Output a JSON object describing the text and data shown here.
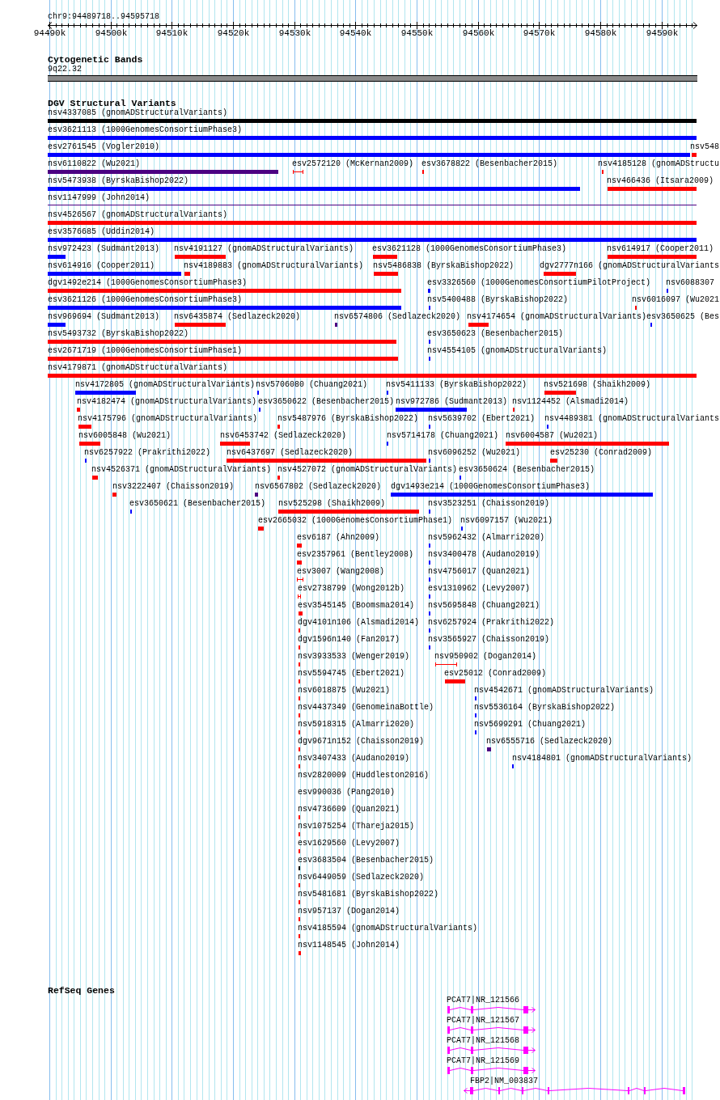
{
  "location": "chr9:94489718..94595718",
  "ruler": {
    "ticks": [
      "94490k",
      "94500k",
      "94510k",
      "94520k",
      "94530k",
      "94540k",
      "94550k",
      "94560k",
      "94570k",
      "94580k",
      "94590k"
    ]
  },
  "cytogenetic_bands": {
    "title": "Cytogenetic Bands",
    "bands": [
      {
        "label": "9q22.32"
      }
    ]
  },
  "dgv": {
    "title": "DGV Structural Variants",
    "rows": [
      {
        "features": [
          {
            "label": "nsv4337085 (gnomADStructuralVariants)",
            "kind": "bar",
            "color": "#000000"
          }
        ]
      },
      {
        "features": [
          {
            "label": "esv3621113 (1000GenomesConsortiumPhase3)",
            "kind": "bar",
            "color": "#0000ff"
          }
        ]
      },
      {
        "features": [
          {
            "label": "esv2761545 (Vogler2010)",
            "kind": "bar",
            "color": "#0000ff"
          },
          {
            "label": "nsv548",
            "kind": "bar",
            "color": "#ff0000"
          }
        ]
      },
      {
        "features": [
          {
            "label": "nsv6110822 (Wu2021)",
            "kind": "bar",
            "color": "#4b0082"
          },
          {
            "label": "esv2572120 (McKernan2009)",
            "kind": "span",
            "color": "#ff0000"
          },
          {
            "label": "esv3678822 (Besenbacher2015)",
            "kind": "bar",
            "color": "#ff0000"
          },
          {
            "label": "nsv4185128 (gnomADStructu",
            "kind": "bar",
            "color": "#ff0000"
          }
        ]
      },
      {
        "features": [
          {
            "label": "nsv5473938 (ByrskaBishop2022)",
            "kind": "bar",
            "color": "#0000ff"
          },
          {
            "label": "nsv466436 (Itsara2009)",
            "kind": "bar",
            "color": "#ff0000"
          }
        ]
      },
      {
        "features": [
          {
            "label": "nsv1147999 (John2014)",
            "kind": "line",
            "color": "#4b0082"
          }
        ]
      },
      {
        "features": [
          {
            "label": "nsv4526567 (gnomADStructuralVariants)",
            "kind": "bar",
            "color": "#ff0000"
          }
        ]
      },
      {
        "features": [
          {
            "label": "esv3576685 (Uddin2014)",
            "kind": "bar",
            "color": "#0000ff"
          }
        ]
      },
      {
        "features": [
          {
            "label": "nsv972423 (Sudmant2013)",
            "kind": "bar",
            "color": "#0000ff"
          },
          {
            "label": "nsv4191127 (gnomADStructuralVariants)",
            "kind": "bar",
            "color": "#ff0000"
          },
          {
            "label": "esv3621128 (1000GenomesConsortiumPhase3)",
            "kind": "bar",
            "color": "#ff0000"
          },
          {
            "label": "nsv614917 (Cooper2011)",
            "kind": "bar",
            "color": "#ff0000"
          }
        ]
      },
      {
        "features": [
          {
            "label": "nsv614916 (Cooper2011)",
            "kind": "bar",
            "color": "#0000ff"
          },
          {
            "label": "nsv4189883 (gnomADStructuralVariants)",
            "kind": "bar",
            "color": "#ff0000"
          },
          {
            "label": "nsv5486838 (ByrskaBishop2022)",
            "kind": "bar",
            "color": "#ff0000"
          },
          {
            "label": "dgv2777n166 (gnomADStructuralVariants",
            "kind": "bar",
            "color": "#ff0000"
          }
        ]
      },
      {
        "features": [
          {
            "label": "dgv1492e214 (1000GenomesConsortiumPhase3)",
            "kind": "bar",
            "color": "#ff0000"
          },
          {
            "label": "esv3326560 (1000GenomesConsortiumPilotProject)",
            "kind": "bar",
            "color": "#0000ff"
          },
          {
            "label": "nsv6088307",
            "kind": "bar",
            "color": "#0000ff"
          }
        ]
      },
      {
        "features": [
          {
            "label": "esv3621126 (1000GenomesConsortiumPhase3)",
            "kind": "bar",
            "color": "#0000ff"
          },
          {
            "label": "nsv5400488 (ByrskaBishop2022)",
            "kind": "bar",
            "color": "#0000ff"
          },
          {
            "label": "nsv6016097 (Wu2021",
            "kind": "bar",
            "color": "#ff0000"
          }
        ]
      },
      {
        "features": [
          {
            "label": "nsv969694 (Sudmant2013)",
            "kind": "bar",
            "color": "#0000ff"
          },
          {
            "label": "nsv6435874 (Sedlazeck2020)",
            "kind": "bar",
            "color": "#ff0000"
          },
          {
            "label": "nsv6574806 (Sedlazeck2020)",
            "kind": "bar",
            "color": "#4b0082"
          },
          {
            "label": "nsv4174654 (gnomADStructuralVariants)",
            "kind": "bar",
            "color": "#ff0000"
          },
          {
            "label": "esv3650625 (Bes",
            "kind": "bar",
            "color": "#0000ff"
          }
        ]
      },
      {
        "features": [
          {
            "label": "nsv5493732 (ByrskaBishop2022)",
            "kind": "bar",
            "color": "#ff0000"
          },
          {
            "label": "esv3650623 (Besenbacher2015)",
            "kind": "bar",
            "color": "#0000ff"
          }
        ]
      },
      {
        "features": [
          {
            "label": "esv2671719 (1000GenomesConsortiumPhase1)",
            "kind": "bar",
            "color": "#ff0000"
          },
          {
            "label": "nsv4554105 (gnomADStructuralVariants)",
            "kind": "bar",
            "color": "#0000ff"
          }
        ]
      },
      {
        "features": [
          {
            "label": "nsv4179871 (gnomADStructuralVariants)",
            "kind": "bar",
            "color": "#ff0000"
          }
        ]
      },
      {
        "features": [
          {
            "label": "nsv4172805 (gnomADStructuralVariants)",
            "kind": "bar",
            "color": "#0000ff"
          },
          {
            "label": "nsv5706080 (Chuang2021)",
            "kind": "bar",
            "color": "#0000ff"
          },
          {
            "label": "nsv5411133 (ByrskaBishop2022)",
            "kind": "bar",
            "color": "#0000ff"
          },
          {
            "label": "nsv521698 (Shaikh2009)",
            "kind": "bar",
            "color": "#ff0000"
          }
        ]
      },
      {
        "features": [
          {
            "label": "nsv4182474 (gnomADStructuralVariants)",
            "kind": "bar",
            "color": "#ff0000"
          },
          {
            "label": "esv3650622 (Besenbacher2015)",
            "kind": "bar",
            "color": "#0000ff"
          },
          {
            "label": "nsv972786 (Sudmant2013)",
            "kind": "bar",
            "color": "#0000ff"
          },
          {
            "label": "nsv1124452 (Alsmadi2014)",
            "kind": "bar",
            "color": "#ff0000"
          }
        ]
      },
      {
        "features": [
          {
            "label": "nsv4175796 (gnomADStructuralVariants)",
            "kind": "bar",
            "color": "#ff0000"
          },
          {
            "label": "nsv5487976 (ByrskaBishop2022)",
            "kind": "bar",
            "color": "#ff0000"
          },
          {
            "label": "nsv5639702 (Ebert2021)",
            "kind": "bar",
            "color": "#0000ff"
          },
          {
            "label": "nsv4489381 (gnomADStructuralVariants",
            "kind": "bar",
            "color": "#0000ff"
          }
        ]
      },
      {
        "features": [
          {
            "label": "nsv6005848 (Wu2021)",
            "kind": "bar",
            "color": "#ff0000"
          },
          {
            "label": "nsv6453742 (Sedlazeck2020)",
            "kind": "bar",
            "color": "#ff0000"
          },
          {
            "label": "nsv5714178 (Chuang2021)",
            "kind": "bar",
            "color": "#0000ff"
          },
          {
            "label": "nsv6004587 (Wu2021)",
            "kind": "bar",
            "color": "#ff0000"
          }
        ]
      },
      {
        "features": [
          {
            "label": "nsv6257922 (Prakrithi2022)",
            "kind": "bar",
            "color": "#0000ff"
          },
          {
            "label": "nsv6437697 (Sedlazeck2020)",
            "kind": "bar",
            "color": "#ff0000"
          },
          {
            "label": "nsv6096252 (Wu2021)",
            "kind": "bar",
            "color": "#0000ff"
          },
          {
            "label": "esv25230 (Conrad2009)",
            "kind": "bar",
            "color": "#ff0000"
          }
        ]
      },
      {
        "features": [
          {
            "label": "nsv4526371 (gnomADStructuralVariants)",
            "kind": "bar",
            "color": "#ff0000"
          },
          {
            "label": "nsv4527072 (gnomADStructuralVariants)",
            "kind": "bar",
            "color": "#ff0000"
          },
          {
            "label": "esv3650624 (Besenbacher2015)",
            "kind": "bar",
            "color": "#0000ff"
          }
        ]
      },
      {
        "features": [
          {
            "label": "nsv3222407 (Chaisson2019)",
            "kind": "bar",
            "color": "#ff0000"
          },
          {
            "label": "nsv6567802 (Sedlazeck2020)",
            "kind": "bar",
            "color": "#4b0082"
          },
          {
            "label": "dgv1493e214 (1000GenomesConsortiumPhase3)",
            "kind": "bar",
            "color": "#0000ff"
          }
        ]
      },
      {
        "features": [
          {
            "label": "esv3650621 (Besenbacher2015)",
            "kind": "bar",
            "color": "#0000ff"
          },
          {
            "label": "nsv525298 (Shaikh2009)",
            "kind": "bar",
            "color": "#ff0000"
          },
          {
            "label": "nsv3523251 (Chaisson2019)",
            "kind": "bar",
            "color": "#0000ff"
          }
        ]
      },
      {
        "features": [
          {
            "label": "esv2665032 (1000GenomesConsortiumPhase1)",
            "kind": "bar",
            "color": "#ff0000"
          },
          {
            "label": "nsv6097157 (Wu2021)",
            "kind": "bar",
            "color": "#0000ff"
          }
        ]
      },
      {
        "features": [
          {
            "label": "esv6187 (Ahn2009)",
            "kind": "bar",
            "color": "#ff0000"
          },
          {
            "label": "nsv5962432 (Almarri2020)",
            "kind": "bar",
            "color": "#0000ff"
          }
        ]
      },
      {
        "features": [
          {
            "label": "esv2357961 (Bentley2008)",
            "kind": "bar",
            "color": "#ff0000"
          },
          {
            "label": "nsv3400478 (Audano2019)",
            "kind": "bar",
            "color": "#0000ff"
          }
        ]
      },
      {
        "features": [
          {
            "label": "esv3007 (Wang2008)",
            "kind": "span",
            "color": "#ff0000"
          },
          {
            "label": "nsv4756017 (Quan2021)",
            "kind": "bar",
            "color": "#0000ff"
          }
        ]
      },
      {
        "features": [
          {
            "label": "esv2738799 (Wong2012b)",
            "kind": "span",
            "color": "#ff0000"
          },
          {
            "label": "esv1310962 (Levy2007)",
            "kind": "bar",
            "color": "#0000ff"
          }
        ]
      },
      {
        "features": [
          {
            "label": "esv3545145 (Boomsma2014)",
            "kind": "bar",
            "color": "#ff0000"
          },
          {
            "label": "nsv5695848 (Chuang2021)",
            "kind": "bar",
            "color": "#0000ff"
          }
        ]
      },
      {
        "features": [
          {
            "label": "dgv4101n106 (Alsmadi2014)",
            "kind": "bar",
            "color": "#ff0000"
          },
          {
            "label": "nsv6257924 (Prakrithi2022)",
            "kind": "bar",
            "color": "#0000ff"
          }
        ]
      },
      {
        "features": [
          {
            "label": "dgv1596n140 (Fan2017)",
            "kind": "bar",
            "color": "#ff0000"
          },
          {
            "label": "nsv3565927 (Chaisson2019)",
            "kind": "bar",
            "color": "#0000ff"
          }
        ]
      },
      {
        "features": [
          {
            "label": "nsv3933533 (Wenger2019)",
            "kind": "bar",
            "color": "#ff0000"
          },
          {
            "label": "nsv950902 (Dogan2014)",
            "kind": "span",
            "color": "#ff0000"
          }
        ]
      },
      {
        "features": [
          {
            "label": "nsv5594745 (Ebert2021)",
            "kind": "bar",
            "color": "#ff0000"
          },
          {
            "label": "esv25012 (Conrad2009)",
            "kind": "bar",
            "color": "#ff0000"
          }
        ]
      },
      {
        "features": [
          {
            "label": "nsv6018875 (Wu2021)",
            "kind": "bar",
            "color": "#ff0000"
          },
          {
            "label": "nsv4542671 (gnomADStructuralVariants)",
            "kind": "bar",
            "color": "#0000ff"
          }
        ]
      },
      {
        "features": [
          {
            "label": "nsv4437349 (GenomeinaBottle)",
            "kind": "bar",
            "color": "#ff0000"
          },
          {
            "label": "nsv5536164 (ByrskaBishop2022)",
            "kind": "bar",
            "color": "#0000ff"
          }
        ]
      },
      {
        "features": [
          {
            "label": "nsv5918315 (Almarri2020)",
            "kind": "bar",
            "color": "#ff0000"
          },
          {
            "label": "nsv5699291 (Chuang2021)",
            "kind": "bar",
            "color": "#0000ff"
          }
        ]
      },
      {
        "features": [
          {
            "label": "dgv9671n152 (Chaisson2019)",
            "kind": "bar",
            "color": "#ff0000"
          },
          {
            "label": "nsv6555716 (Sedlazeck2020)",
            "kind": "bar",
            "color": "#4b0082"
          }
        ]
      },
      {
        "features": [
          {
            "label": "nsv3407433 (Audano2019)",
            "kind": "bar",
            "color": "#ff0000"
          },
          {
            "label": "nsv4184801 (gnomADStructuralVariants)",
            "kind": "bar",
            "color": "#0000ff"
          }
        ]
      },
      {
        "features": [
          {
            "label": "nsv2820009 (Huddleston2016)",
            "kind": "label"
          }
        ]
      },
      {
        "features": [
          {
            "label": "esv990036 (Pang2010)",
            "kind": "label"
          }
        ]
      },
      {
        "features": [
          {
            "label": "nsv4736609 (Quan2021)",
            "kind": "bar",
            "color": "#ff0000"
          }
        ]
      },
      {
        "features": [
          {
            "label": "nsv1075254 (Thareja2015)",
            "kind": "bar",
            "color": "#ff0000"
          }
        ]
      },
      {
        "features": [
          {
            "label": "esv1629560 (Levy2007)",
            "kind": "bar",
            "color": "#ff0000"
          }
        ]
      },
      {
        "features": [
          {
            "label": "esv3683504 (Besenbacher2015)",
            "kind": "bar",
            "color": "#000000"
          }
        ]
      },
      {
        "features": [
          {
            "label": "nsv6449059 (Sedlazeck2020)",
            "kind": "bar",
            "color": "#ff0000"
          }
        ]
      },
      {
        "features": [
          {
            "label": "nsv5481681 (ByrskaBishop2022)",
            "kind": "bar",
            "color": "#ff0000"
          }
        ]
      },
      {
        "features": [
          {
            "label": "nsv957137 (Dogan2014)",
            "kind": "bar",
            "color": "#ff0000"
          }
        ]
      },
      {
        "features": [
          {
            "label": "nsv4185594 (gnomADStructuralVariants)",
            "kind": "bar",
            "color": "#ff0000"
          }
        ]
      },
      {
        "features": [
          {
            "label": "nsv1148545 (John2014)",
            "kind": "bar",
            "color": "#ff0000"
          }
        ]
      }
    ]
  },
  "refseq": {
    "title": "RefSeq Genes",
    "transcripts": [
      {
        "label": "PCAT7|NR_121566",
        "reverse": false
      },
      {
        "label": "PCAT7|NR_121567",
        "reverse": false
      },
      {
        "label": "PCAT7|NR_121568",
        "reverse": false
      },
      {
        "label": "PCAT7|NR_121569",
        "reverse": false
      },
      {
        "label": "FBP2|NM_003837",
        "reverse": true
      }
    ]
  }
}
